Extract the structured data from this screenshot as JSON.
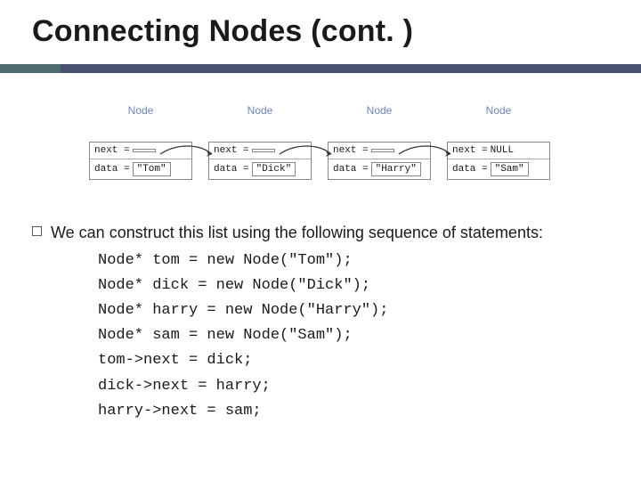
{
  "title": "Connecting Nodes (cont. )",
  "nodes": [
    {
      "label": "Node",
      "next": "",
      "data": "\"Tom\""
    },
    {
      "label": "Node",
      "next": "",
      "data": "\"Dick\""
    },
    {
      "label": "Node",
      "next": "",
      "data": "\"Harry\""
    },
    {
      "label": "Node",
      "next": "NULL",
      "data": "\"Sam\""
    }
  ],
  "field_labels": {
    "next": "next =",
    "data": "data ="
  },
  "body": "We can construct this list using the following sequence of statements:",
  "code_lines": [
    "Node* tom = new Node(\"Tom\");",
    "Node* dick = new Node(\"Dick\");",
    "Node* harry = new Node(\"Harry\");",
    "Node* sam = new Node(\"Sam\");",
    "tom->next = dick;",
    "dick->next = harry;",
    "harry->next = sam;"
  ]
}
